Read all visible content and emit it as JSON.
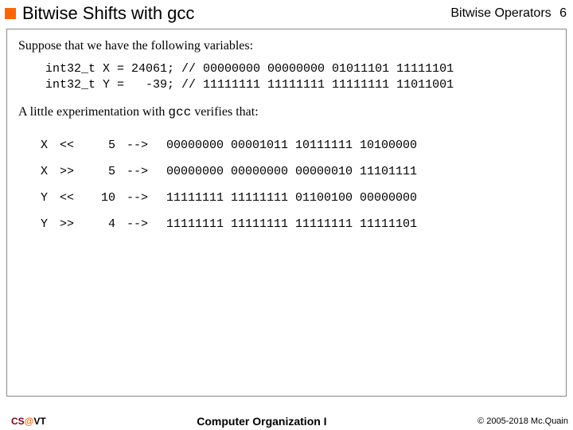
{
  "header": {
    "title": "Bitwise Shifts with gcc",
    "section": "Bitwise Operators",
    "page": "6"
  },
  "body": {
    "intro1": "Suppose that we have the following variables:",
    "code1_l1": "int32_t X = 24061; // 00000000 00000000 01011101 11111101",
    "code1_l2": "int32_t Y =   -39; // 11111111 11111111 11111111 11011001",
    "intro2a": "A little experimentation with ",
    "intro2_code": "gcc",
    "intro2b": " verifies that:",
    "rows": {
      "r0": {
        "var": "X",
        "op": "<<",
        "n": "5",
        "arr": "-->",
        "bits": "00000000 00001011 10111111 10100000"
      },
      "r1": {
        "var": "X",
        "op": ">>",
        "n": "5",
        "arr": "-->",
        "bits": "00000000 00000000 00000010 11101111"
      },
      "r2": {
        "var": "Y",
        "op": "<<",
        "n": "10",
        "arr": "-->",
        "bits": "11111111 11111111 01100100 00000000"
      },
      "r3": {
        "var": "Y",
        "op": ">>",
        "n": "4",
        "arr": "-->",
        "bits": "11111111 11111111 11111111 11111101"
      }
    }
  },
  "footer": {
    "left_cs": "CS",
    "left_at": "@",
    "left_vt": "VT",
    "center": "Computer Organization I",
    "right": "© 2005-2018 Mc.Quain"
  }
}
